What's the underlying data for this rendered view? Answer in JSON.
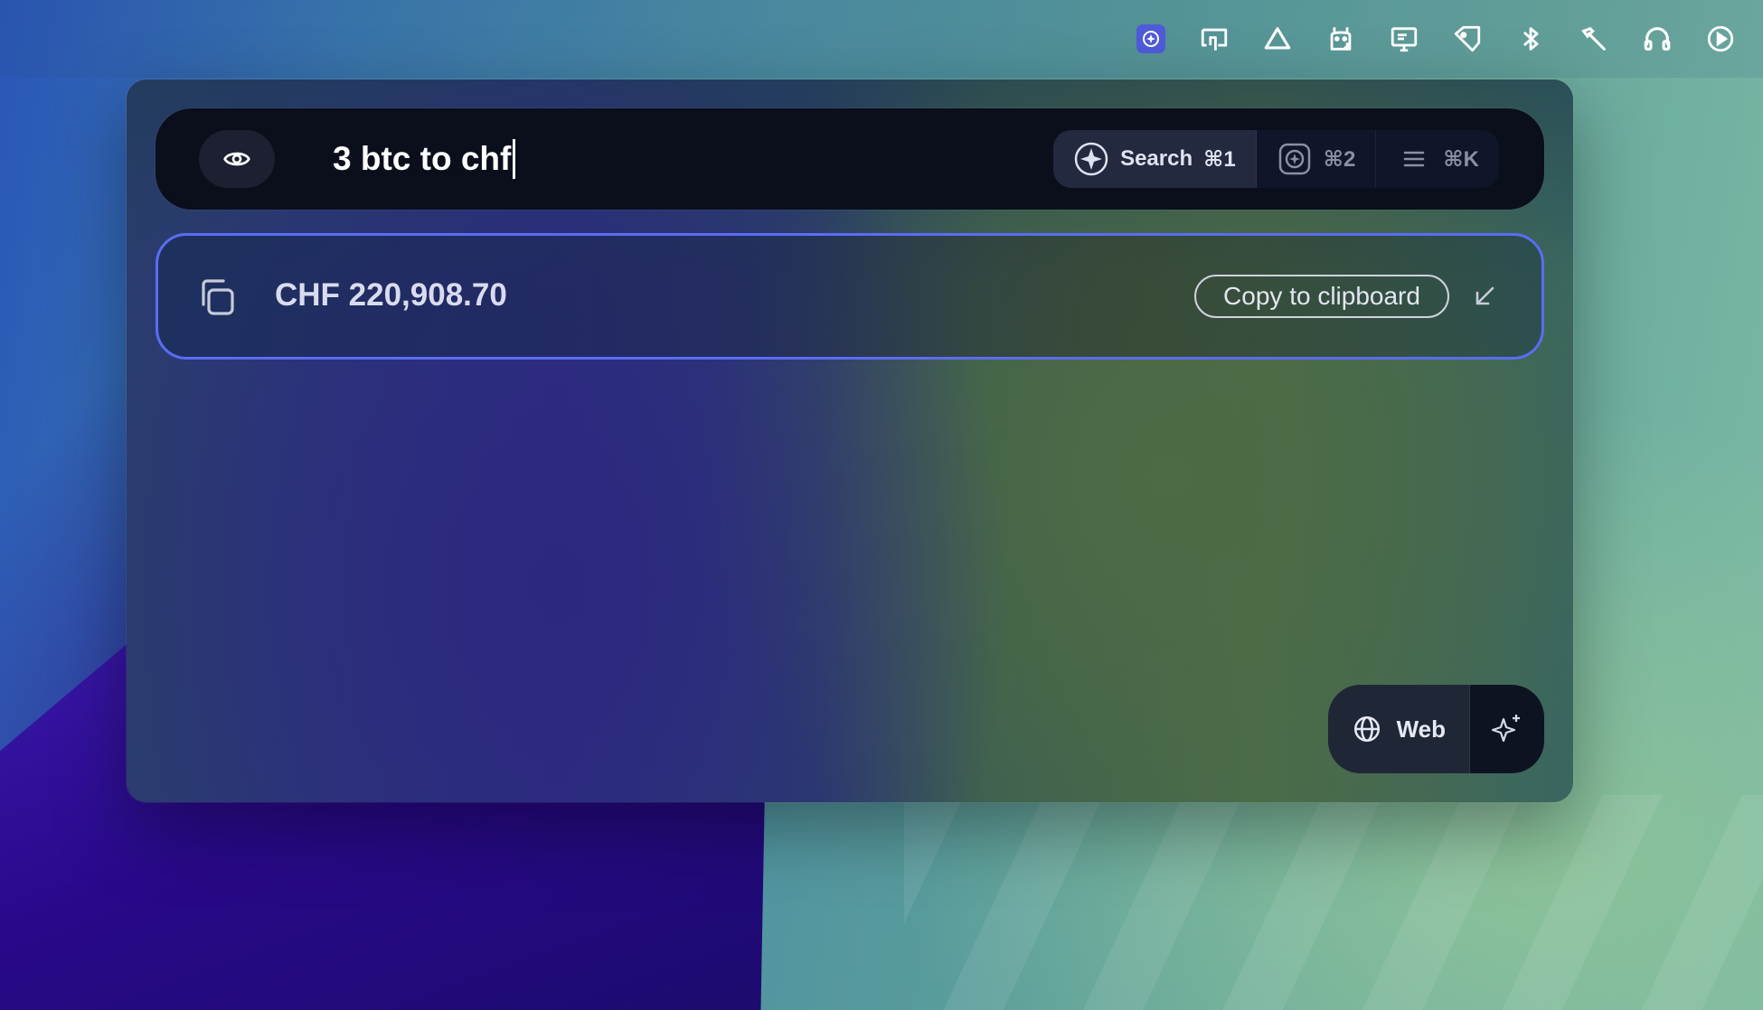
{
  "menubar": {
    "icons": [
      {
        "name": "raycast-icon",
        "active": true
      },
      {
        "name": "screen-share-icon"
      },
      {
        "name": "drive-icon"
      },
      {
        "name": "llama-download-icon"
      },
      {
        "name": "display-icon"
      },
      {
        "name": "tag-icon"
      },
      {
        "name": "bluetooth-icon"
      },
      {
        "name": "hammer-icon"
      },
      {
        "name": "headphones-icon"
      },
      {
        "name": "play-circle-icon"
      }
    ]
  },
  "search": {
    "query": "3 btc to chf",
    "modes": [
      {
        "label": "Search",
        "shortcut": "⌘1",
        "icon": "sparkle-circle-icon",
        "selected": true
      },
      {
        "label": "",
        "shortcut": "⌘2",
        "icon": "square-sparkle-icon",
        "selected": false
      },
      {
        "label": "",
        "shortcut": "⌘K",
        "icon": "menu-lines-icon",
        "selected": false
      }
    ]
  },
  "result": {
    "value": "CHF 220,908.70",
    "action_label": "Copy to clipboard"
  },
  "footer": {
    "web_label": "Web"
  },
  "colors": {
    "accent_border": "#5b6df2",
    "searchbar_bg": "#0b0f1c",
    "active_menubar_chip": "#4f5bd8"
  }
}
